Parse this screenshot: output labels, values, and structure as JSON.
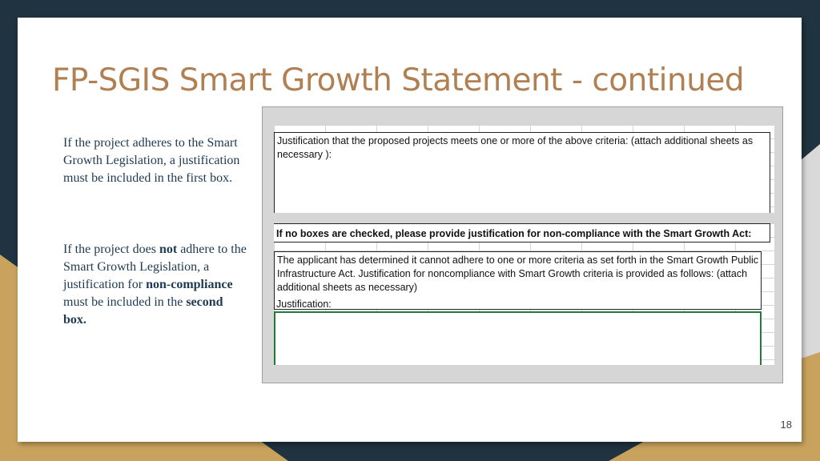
{
  "slide": {
    "title": "FP-SGIS Smart Growth Statement - continued",
    "page_number": "18"
  },
  "left_text": {
    "para1": "If the project adheres to the Smart Growth Legislation, a justification must be included in the first box.",
    "para2_part1": "If the project does ",
    "para2_not": "not",
    "para2_part2": " adhere to the Smart Growth Legislation, a justification for ",
    "para2_noncompliance": "non-compliance",
    "para2_part3": " must be included in the ",
    "para2_second_box": "second box."
  },
  "form": {
    "box1_text": "Justification that the proposed projects meets one or more of the above criteria: (attach additional sheets as necessary ):",
    "box2_header": "If no boxes are checked, please provide justification for non-compliance with the Smart Growth Act:",
    "box2_text": "The applicant has determined it cannot adhere to one or more criteria as set forth in the Smart Growth Public Infrastructure Act.  Justification for noncompliance with Smart Growth criteria is provided as follows: (attach additional sheets as necessary)",
    "justification_label": "Justification:"
  },
  "colors": {
    "title": "#b07f52",
    "body_text": "#1f3a50",
    "background_dark": "#1f3340",
    "accent_gold": "#c9a35d",
    "input_border_green": "#1e7b3b"
  }
}
